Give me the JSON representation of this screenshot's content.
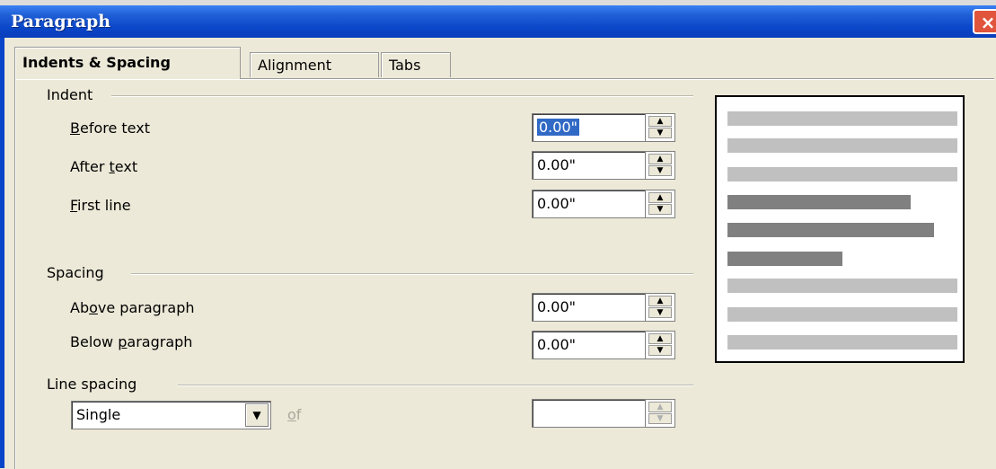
{
  "window": {
    "title": "Paragraph",
    "close_symbol": "×"
  },
  "tabs": [
    {
      "label": "Indents & Spacing",
      "active": true
    },
    {
      "label": "Alignment",
      "active": false
    },
    {
      "label": "Tabs",
      "active": false
    }
  ],
  "indent": {
    "group_label": "Indent",
    "before_text": {
      "label_pre": "",
      "mnemonic": "B",
      "label_post": "efore text",
      "value": "0.00\""
    },
    "after_text": {
      "label_pre": "After ",
      "mnemonic": "t",
      "label_post": "ext",
      "value": "0.00\""
    },
    "first_line": {
      "label_pre": "",
      "mnemonic": "F",
      "label_post": "irst line",
      "value": "0.00\""
    }
  },
  "spacing": {
    "group_label": "Spacing",
    "above": {
      "label_pre": "Ab",
      "mnemonic": "o",
      "label_post": "ve paragraph",
      "value": "0.00\""
    },
    "below": {
      "label_pre": "Below ",
      "mnemonic": "p",
      "label_post": "aragraph",
      "value": "0.00\""
    }
  },
  "line_spacing": {
    "group_label": "Line spacing",
    "selected": "Single",
    "of_label_mnemonic": "o",
    "of_label_rest": "f",
    "value": ""
  },
  "preview": {
    "light_color": "#c0c0c0",
    "dark_color": "#808080"
  },
  "icons": {
    "spin_up": "▲",
    "spin_down": "▼",
    "dropdown_arrow": "▼"
  }
}
